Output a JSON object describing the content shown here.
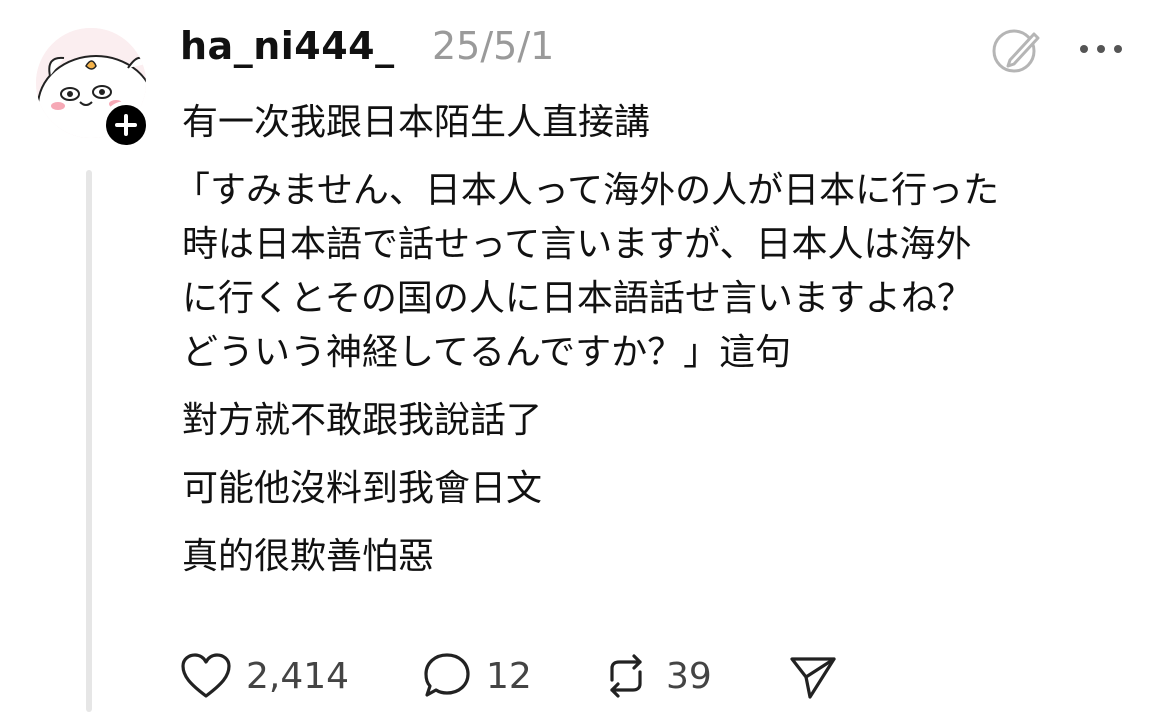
{
  "post": {
    "username": "ha_ni444_",
    "date": "25/5/1",
    "lines": [
      "有一次我跟日本陌生人直接講",
      "「すみません、日本人って海外の人が日本に行った",
      "時は日本語で話せって言いますが、日本人は海外",
      "に行くとその国の人に日本語話せ言いますよね？",
      "どういう神経してるんですか？」這句",
      "對方就不敢跟我說話了",
      "可能他沒料到我會日文",
      "真的很欺善怕惡"
    ]
  },
  "actions": {
    "likes": "2,414",
    "replies": "12",
    "reposts": "39"
  },
  "icons": {
    "avatar": "cartoon-hamster-avatar",
    "follow": "plus-icon",
    "edit": "edit-circle-icon",
    "more": "more-dots-icon",
    "like": "heart-icon",
    "reply": "comment-bubble-icon",
    "repost": "repost-arrows-icon",
    "share": "send-paper-plane-icon"
  },
  "colors": {
    "text": "#111111",
    "muted": "#9a9a9a",
    "thread_line": "#e6e6e6",
    "avatar_bg": "#fbeef0"
  }
}
